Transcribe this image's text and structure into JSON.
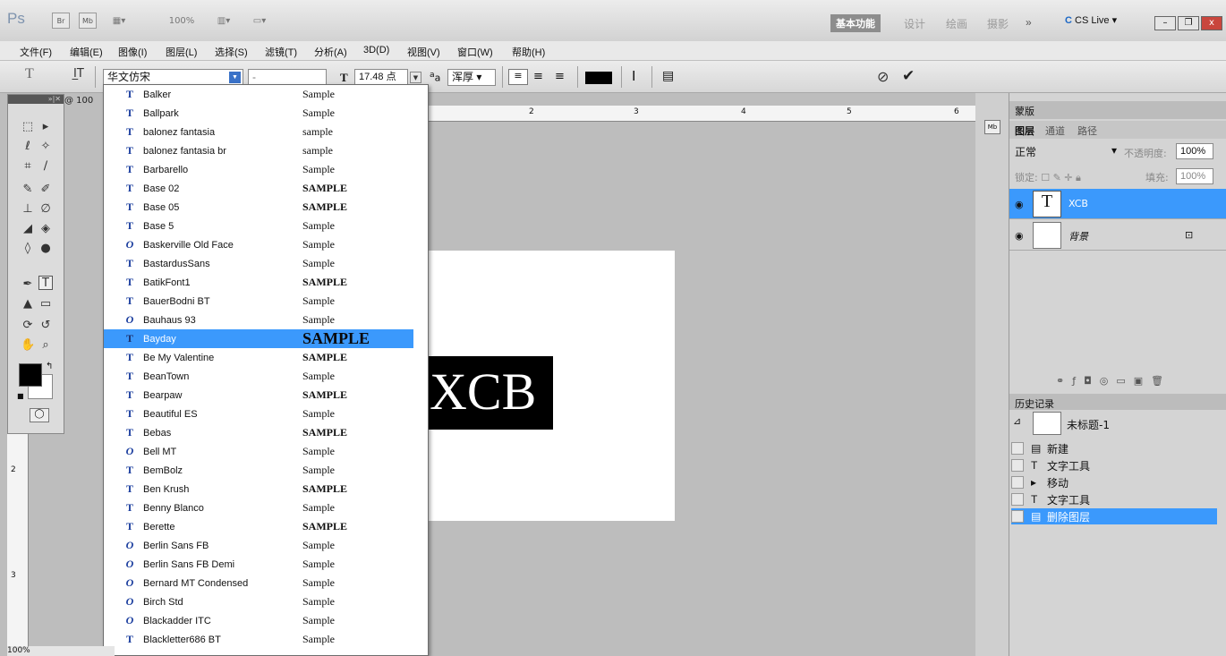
{
  "app": {
    "logo": "Ps",
    "bridge": "Br",
    "mini_bridge": "Mb",
    "zoom": "100%",
    "workspaces": [
      "基本功能",
      "设计",
      "绘画",
      "摄影"
    ],
    "more": "»",
    "cs_live": "CS Live",
    "window_controls": {
      "minimize": "–",
      "restore": "❐",
      "close": "x"
    }
  },
  "menu": [
    "文件(F)",
    "编辑(E)",
    "图像(I)",
    "图层(L)",
    "选择(S)",
    "滤镜(T)",
    "分析(A)",
    "3D(D)",
    "视图(V)",
    "窗口(W)",
    "帮助(H)"
  ],
  "options": {
    "tool_icon": "T",
    "font_family": "华文仿宋",
    "font_style": "-",
    "font_size": "17.48 点",
    "aa_label": "a",
    "aa_value": "浑厚",
    "commit": "✔",
    "cancel": "⊘"
  },
  "document": {
    "tab": "@ 100",
    "zoom_status": "100%",
    "text": "XCB",
    "ruler_top": [
      "2",
      "3",
      "4",
      "5",
      "6"
    ],
    "ruler_left": [
      "2",
      "3"
    ]
  },
  "font_list": [
    {
      "icon": "T",
      "name": "Balker",
      "sample": "Sample"
    },
    {
      "icon": "T",
      "name": "Ballpark",
      "sample": "Sample"
    },
    {
      "icon": "T",
      "name": "balonez fantasia",
      "sample": "sample"
    },
    {
      "icon": "T",
      "name": "balonez fantasia br",
      "sample": "sample"
    },
    {
      "icon": "T",
      "name": "Barbarello",
      "sample": "Sample"
    },
    {
      "icon": "T",
      "name": "Base 02",
      "sample": "SAMPLE"
    },
    {
      "icon": "T",
      "name": "Base 05",
      "sample": "SAMPLE"
    },
    {
      "icon": "T",
      "name": "Base 5",
      "sample": "Sample"
    },
    {
      "icon": "O",
      "name": "Baskerville Old Face",
      "sample": "Sample"
    },
    {
      "icon": "T",
      "name": "BastardusSans",
      "sample": "Sample"
    },
    {
      "icon": "T",
      "name": "BatikFont1",
      "sample": "SAMPLE"
    },
    {
      "icon": "T",
      "name": "BauerBodni BT",
      "sample": "Sample"
    },
    {
      "icon": "O",
      "name": "Bauhaus 93",
      "sample": "Sample"
    },
    {
      "icon": "T",
      "name": "Bayday",
      "sample": "SAMPLE",
      "selected": true
    },
    {
      "icon": "T",
      "name": "Be My Valentine",
      "sample": "SAMPLE"
    },
    {
      "icon": "T",
      "name": "BeanTown",
      "sample": "Sample"
    },
    {
      "icon": "T",
      "name": "Bearpaw",
      "sample": "SAMPLE"
    },
    {
      "icon": "T",
      "name": "Beautiful ES",
      "sample": "Sample"
    },
    {
      "icon": "T",
      "name": "Bebas",
      "sample": "SAMPLE"
    },
    {
      "icon": "O",
      "name": "Bell MT",
      "sample": "Sample"
    },
    {
      "icon": "T",
      "name": "BemBolz",
      "sample": "Sample"
    },
    {
      "icon": "T",
      "name": "Ben Krush",
      "sample": "SAMPLE"
    },
    {
      "icon": "T",
      "name": "Benny Blanco",
      "sample": "Sample"
    },
    {
      "icon": "T",
      "name": "Berette",
      "sample": "SAMPLE"
    },
    {
      "icon": "O",
      "name": "Berlin Sans FB",
      "sample": "Sample"
    },
    {
      "icon": "O",
      "name": "Berlin Sans FB Demi",
      "sample": "Sample"
    },
    {
      "icon": "O",
      "name": "Bernard MT Condensed",
      "sample": "Sample"
    },
    {
      "icon": "O",
      "name": "Birch Std",
      "sample": "Sample"
    },
    {
      "icon": "O",
      "name": "Blackadder ITC",
      "sample": "Sample"
    },
    {
      "icon": "T",
      "name": "Blackletter686 BT",
      "sample": "Sample"
    }
  ],
  "panels": {
    "masks_tab": "蒙版",
    "layer_tabs": [
      "图层",
      "通道",
      "路径"
    ],
    "blend_mode": "正常",
    "opacity_label": "不透明度:",
    "opacity_value": "100%",
    "lock_label": "锁定:",
    "fill_label": "填充:",
    "fill_value": "100%",
    "layers": [
      {
        "name": "XCB",
        "type": "text",
        "selected": true
      },
      {
        "name": "背景",
        "type": "background",
        "selected": false
      }
    ],
    "history_tab": "历史记录",
    "history_snapshot": "未标题-1",
    "history": [
      {
        "icon": "doc-icon",
        "label": "新建"
      },
      {
        "icon": "type-icon",
        "label": "文字工具"
      },
      {
        "icon": "move-icon",
        "label": "移动"
      },
      {
        "icon": "type-icon",
        "label": "文字工具"
      },
      {
        "icon": "doc-icon",
        "label": "删除图层",
        "selected": true
      }
    ]
  },
  "colors": {
    "accent": "#3b99fc",
    "selected_layer": "#3b99fc"
  }
}
